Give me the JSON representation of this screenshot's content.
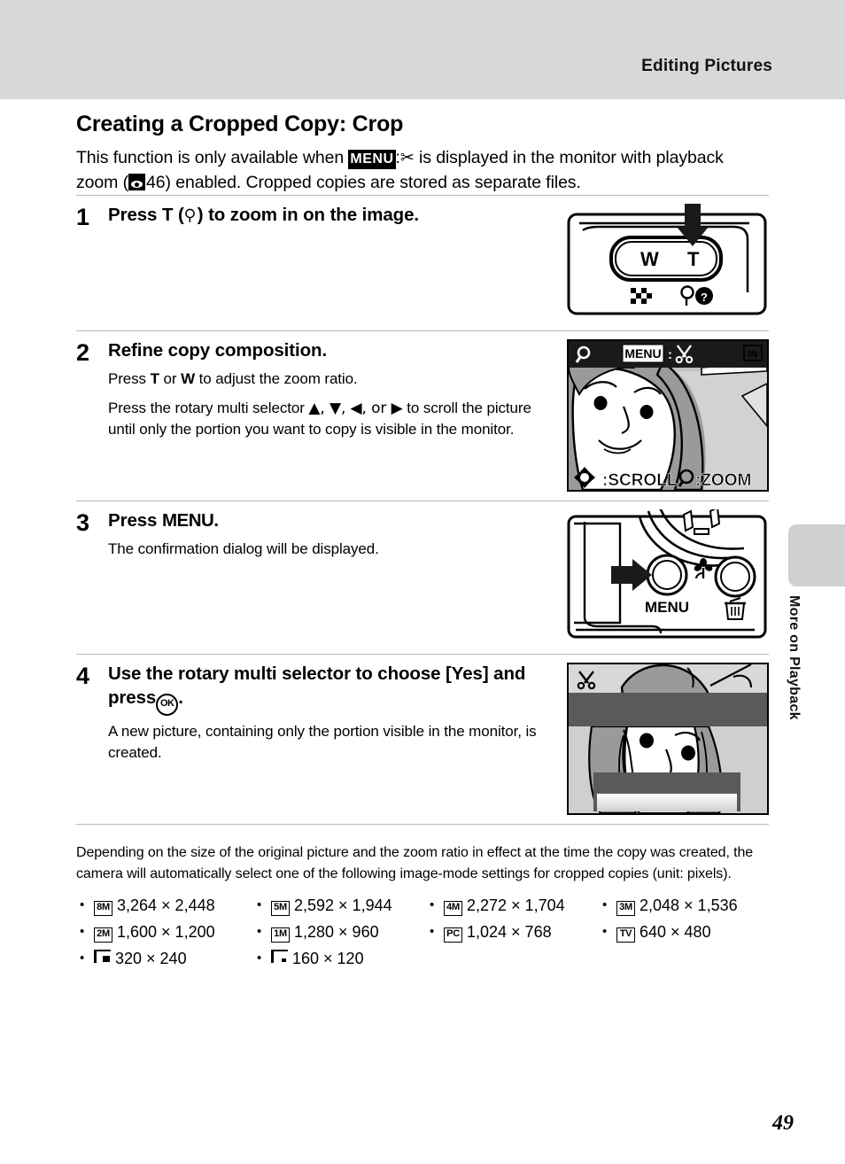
{
  "header": {
    "running_title": "Editing Pictures"
  },
  "side_tab": {
    "label": "More on Playback"
  },
  "page": {
    "heading": "Creating a Cropped Copy: Crop",
    "intro_part1": "This function is only available when",
    "intro_menu_badge": "MENU",
    "intro_scissors_icon": "scissors-icon",
    "intro_part2": "is displayed in the monitor with playback zoom (",
    "intro_ref_icon": "playback-eye-icon",
    "intro_ref_page": "46",
    "intro_part3": ") enabled. Cropped copies are stored as separate files.",
    "page_number": "49"
  },
  "steps": [
    {
      "number": "1",
      "title_pre": "Press",
      "title_key": "T",
      "title_paren_icon": "magnifier-icon",
      "title_post": "to zoom in on the image.",
      "figure": {
        "name": "zoom-control-figure",
        "wide_label": "W",
        "tele_label": "T",
        "thumbnail_icon": "thumbnail-grid-icon",
        "help_icon": "magnifier-help-icon",
        "arrow": "down-arrow"
      }
    },
    {
      "number": "2",
      "title": "Refine copy composition.",
      "sub1_pre": "Press",
      "sub1_key1": "T",
      "sub1_mid": "or",
      "sub1_key2": "W",
      "sub1_post": "to adjust the zoom ratio.",
      "sub2_pre": "Press the rotary multi selector",
      "sub2_arrows": "▲, ▼, ◀, or ▶",
      "sub2_post": "to scroll the picture until only the portion you want to copy is visible in the monitor.",
      "figure": {
        "name": "playback-zoom-monitor-figure",
        "top_magnifier_icon": "magnifier-icon",
        "top_menu_badge": "MENU",
        "top_scissors_icon": "scissors-icon",
        "top_right_badge": "IN",
        "bottom_scroll_label": ":SCROLL",
        "bottom_zoom_label": ":ZOOM",
        "bottom_dpad_icon": "dpad-icon",
        "bottom_magnifier_icon": "magnifier-icon"
      }
    },
    {
      "number": "3",
      "title_pre": "Press",
      "title_key": "MENU",
      "title_post": ".",
      "sub1": "The confirmation dialog will be displayed.",
      "figure": {
        "name": "menu-button-figure",
        "menu_label": "MENU",
        "macro_icon": "macro-flower-icon",
        "delete_icon": "trash-icon",
        "arrow": "right-arrow"
      }
    },
    {
      "number": "4",
      "title_pre": "Use the rotary multi selector to choose [Yes] and press",
      "title_ok": "OK",
      "title_post": ".",
      "sub1": "A new picture, containing only the portion visible in the monitor, is created.",
      "figure": {
        "name": "crop-confirmation-monitor-figure",
        "scissors_icon": "scissors-icon"
      }
    }
  ],
  "note": "Depending on the size of the original picture and the zoom ratio in effect at the time the copy was created, the camera will automatically select one of the following image-mode settings for cropped copies (unit: pixels).",
  "image_modes": [
    [
      {
        "icon": "8M",
        "icon_kind": "boxed",
        "size": "3,264 × 2,448"
      },
      {
        "icon": "5M",
        "icon_kind": "boxed",
        "size": "2,592 × 1,944"
      },
      {
        "icon": "4M",
        "icon_kind": "boxed",
        "size": "2,272 × 1,704"
      },
      {
        "icon": "3M",
        "icon_kind": "boxed",
        "size": "2,048 × 1,536"
      }
    ],
    [
      {
        "icon": "2M",
        "icon_kind": "boxed",
        "size": "1,600 × 1,200"
      },
      {
        "icon": "1M",
        "icon_kind": "boxed",
        "size": "1,280 × 960"
      },
      {
        "icon": "PC",
        "icon_kind": "boxed",
        "size": "1,024 × 768"
      },
      {
        "icon": "TV",
        "icon_kind": "boxed",
        "size": "640 × 480"
      }
    ],
    [
      {
        "icon": "corner-large",
        "icon_kind": "corner",
        "size": "320 × 240"
      },
      {
        "icon": "corner-small",
        "icon_kind": "corner",
        "size": "160 × 120"
      }
    ]
  ],
  "colors": {
    "header_band": "#d8d8d8",
    "side_tab": "#d0d0d0",
    "rule": "#b8b8b8",
    "ink": "#000000"
  }
}
